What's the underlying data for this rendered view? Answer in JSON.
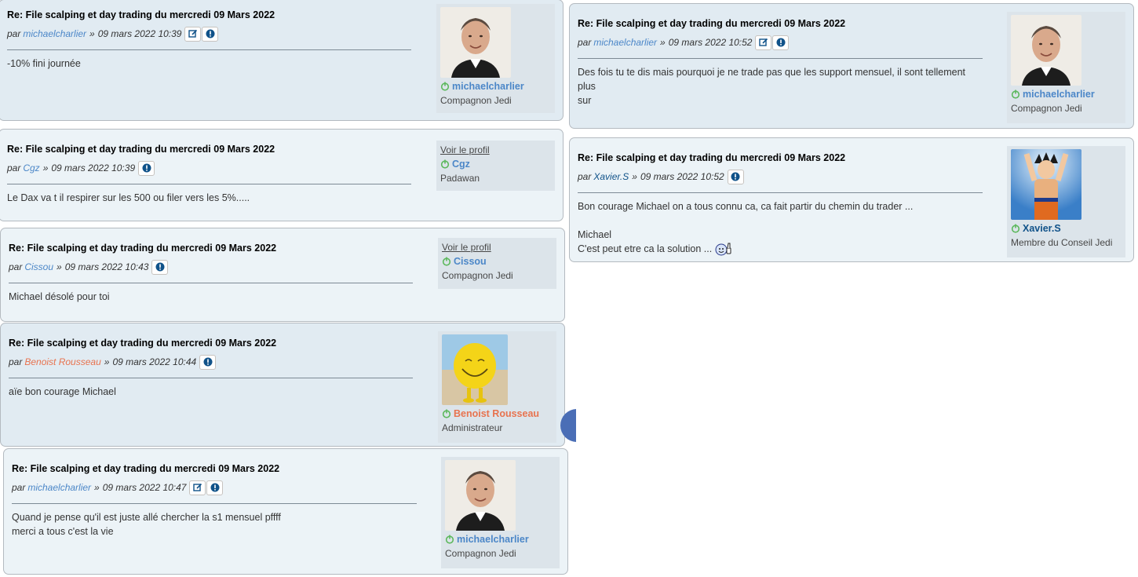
{
  "posts": [
    {
      "title": "Re: File scalping et day trading du mercredi 09 Mars 2022",
      "by": "par",
      "username": "michaelcharlier",
      "sep": "»",
      "date": "09 mars 2022 10:39",
      "lines": [
        "-10% fini journée"
      ],
      "profile": {
        "name": "michaelcharlier",
        "rank": "Compagnon Jedi"
      }
    },
    {
      "title": "Re: File scalping et day trading du mercredi 09 Mars 2022",
      "by": "par",
      "username": "Cgz",
      "sep": "»",
      "date": "09 mars 2022 10:39",
      "lines": [
        "Le Dax va t il respirer sur les 500 ou filer vers les 5%....."
      ],
      "profile": {
        "link": "Voir le profil",
        "name": "Cgz",
        "rank": "Padawan"
      }
    },
    {
      "title": "Re: File scalping et day trading du mercredi 09 Mars 2022",
      "by": "par",
      "username": "Cissou",
      "sep": "»",
      "date": "09 mars 2022 10:43",
      "lines": [
        "Michael désolé pour toi"
      ],
      "profile": {
        "link": "Voir le profil",
        "name": "Cissou",
        "rank": "Compagnon Jedi"
      }
    },
    {
      "title": "Re: File scalping et day trading du mercredi 09 Mars 2022",
      "by": "par",
      "username": "Benoist Rousseau",
      "sep": "»",
      "date": "09 mars 2022 10:44",
      "lines": [
        "aïe bon courage Michael"
      ],
      "profile": {
        "name": "Benoist Rousseau",
        "rank": "Administrateur"
      }
    },
    {
      "title": "Re: File scalping et day trading du mercredi 09 Mars 2022",
      "by": "par",
      "username": "michaelcharlier",
      "sep": "»",
      "date": "09 mars 2022 10:47",
      "lines": [
        "Quand je pense qu'il est juste allé chercher la s1 mensuel pffff",
        "merci a tous c'est la vie"
      ],
      "profile": {
        "name": "michaelcharlier",
        "rank": "Compagnon Jedi"
      }
    },
    {
      "title": "Re: File scalping et day trading du mercredi 09 Mars 2022",
      "by": "par",
      "username": "michaelcharlier",
      "sep": "»",
      "date": "09 mars 2022 10:52",
      "lines": [
        "Des fois tu te dis mais pourquoi je ne trade pas que les support mensuel, il sont tellement plus",
        "sur"
      ],
      "profile": {
        "name": "michaelcharlier",
        "rank": "Compagnon Jedi"
      }
    },
    {
      "title": "Re: File scalping et day trading du mercredi 09 Mars 2022",
      "by": "par",
      "username": "Xavier.S",
      "sep": "»",
      "date": "09 mars 2022 10:52",
      "lines": [
        "Bon courage Michael on a tous connu ca, ca fait partir du chemin du trader ...",
        "",
        "Michael",
        "C'est peut etre ca la solution ..."
      ],
      "profile": {
        "name": "Xavier.S",
        "rank": "Membre du Conseil Jedi"
      }
    }
  ],
  "colors": {
    "bg1": "#ecf3f7",
    "bg2": "#e1ebf2",
    "profile_bg": "#dce4ea",
    "username_light": "#4c87c8",
    "username_dark": "#105289",
    "username_admin": "#e8734f",
    "online_green": "#5cb85c"
  },
  "icons": {
    "edit": "edit-icon",
    "report": "report-icon",
    "online": "online-power-icon",
    "smiley": "thumbs-up-smiley-icon"
  }
}
